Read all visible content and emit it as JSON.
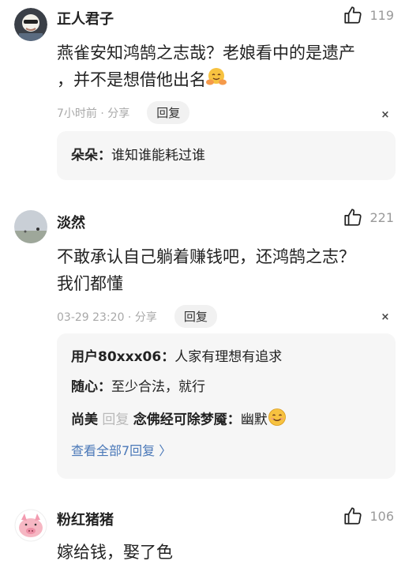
{
  "comments": [
    {
      "username": "正人君子",
      "likes": "119",
      "text_line1": "燕雀安知鸿鹄之志哉？老娘看中的是遗产",
      "text_line2": "，并不是想借他出名",
      "time": "7小时前 · 分享",
      "reply_label": "回复",
      "close": "×",
      "replies": [
        {
          "name": "朵朵：",
          "text": "谁知谁能耗过谁"
        }
      ]
    },
    {
      "username": "淡然",
      "likes": "221",
      "text_line1": "不敢承认自己躺着赚钱吧，还鸿鹄之志？",
      "text_line2": "我们都懂",
      "time": "03-29 23:20 · 分享",
      "reply_label": "回复",
      "close": "×",
      "replies": [
        {
          "name": "用户80xxx06：",
          "text": "人家有理想有追求"
        },
        {
          "name": "随心：",
          "text": "至少合法，就行"
        },
        {
          "name": "尚美",
          "mid": " 回复 ",
          "name2": "念佛经可除梦魇：",
          "text": "幽默"
        }
      ],
      "view_all": "查看全部7回复 〉"
    },
    {
      "username": "粉红猪猪",
      "likes": "106",
      "text_line1": "嫁给钱，娶了色"
    }
  ],
  "icons": {
    "like": "thumbs-up-icon",
    "emoji_hug": "hugging-face-icon",
    "emoji_smile": "smiling-face-icon"
  }
}
